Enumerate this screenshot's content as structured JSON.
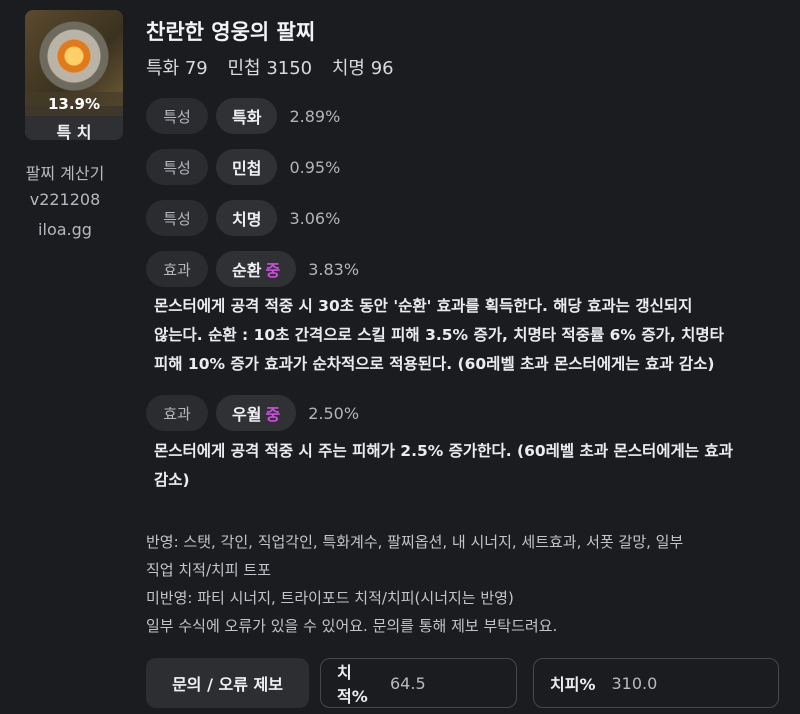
{
  "item": {
    "percent": "13.9%",
    "stat_label": "특 치",
    "title": "찬란한 영웅의 팔찌",
    "stats": [
      "특화 79",
      "민첩 3150",
      "치명 96"
    ]
  },
  "sidebar": {
    "app_name": "팔찌 계산기",
    "version": "v221208",
    "site": "iloa.gg"
  },
  "options": [
    {
      "kind": "특성",
      "name": "특화",
      "level": "",
      "value": "2.89%"
    },
    {
      "kind": "특성",
      "name": "민첩",
      "level": "",
      "value": "0.95%"
    },
    {
      "kind": "특성",
      "name": "치명",
      "level": "",
      "value": "3.06%"
    },
    {
      "kind": "효과",
      "name": "순환",
      "level": "중",
      "value": "3.83%",
      "desc": [
        "몬스터에게 공격 적중 시 30초 동안 '순환' 효과를 획득한다. 해당 효과는 갱신되지",
        "않는다. 순환 : 10초 간격으로 스킬 피해 3.5% 증가, 치명타 적중률 6% 증가, 치명타",
        "피해 10% 증가 효과가 순차적으로 적용된다. (60레벨 초과 몬스터에게는 효과 감소)"
      ]
    },
    {
      "kind": "효과",
      "name": "우월",
      "level": "중",
      "value": "2.50%",
      "desc": [
        "몬스터에게 공격 적중 시 주는 피해가 2.5% 증가한다. (60레벨 초과 몬스터에게는 효과",
        "감소)"
      ]
    }
  ],
  "notes": [
    "반영: 스탯, 각인, 직업각인, 특화계수, 팔찌옵션, 내 시너지, 세트효과, 서폿 갈망, 일부",
    "직업 치적/치피 트포",
    "미반영: 파티 시너지, 트라이포드 치적/치피(시너지는 반영)",
    "일부 수식에 오류가 있을 수 있어요. 문의를 통해 제보 부탁드려요."
  ],
  "footer": {
    "report_button": "문의 / 오류 제보",
    "crit_rate_label": "치적%",
    "crit_rate_value": "64.5",
    "crit_dmg_label": "치피%",
    "crit_dmg_value": "310.0"
  },
  "colors": {
    "background": "#1b1c1f",
    "level_accent": "#d24ce0"
  },
  "icons": {
    "item": "bracelet-icon"
  }
}
